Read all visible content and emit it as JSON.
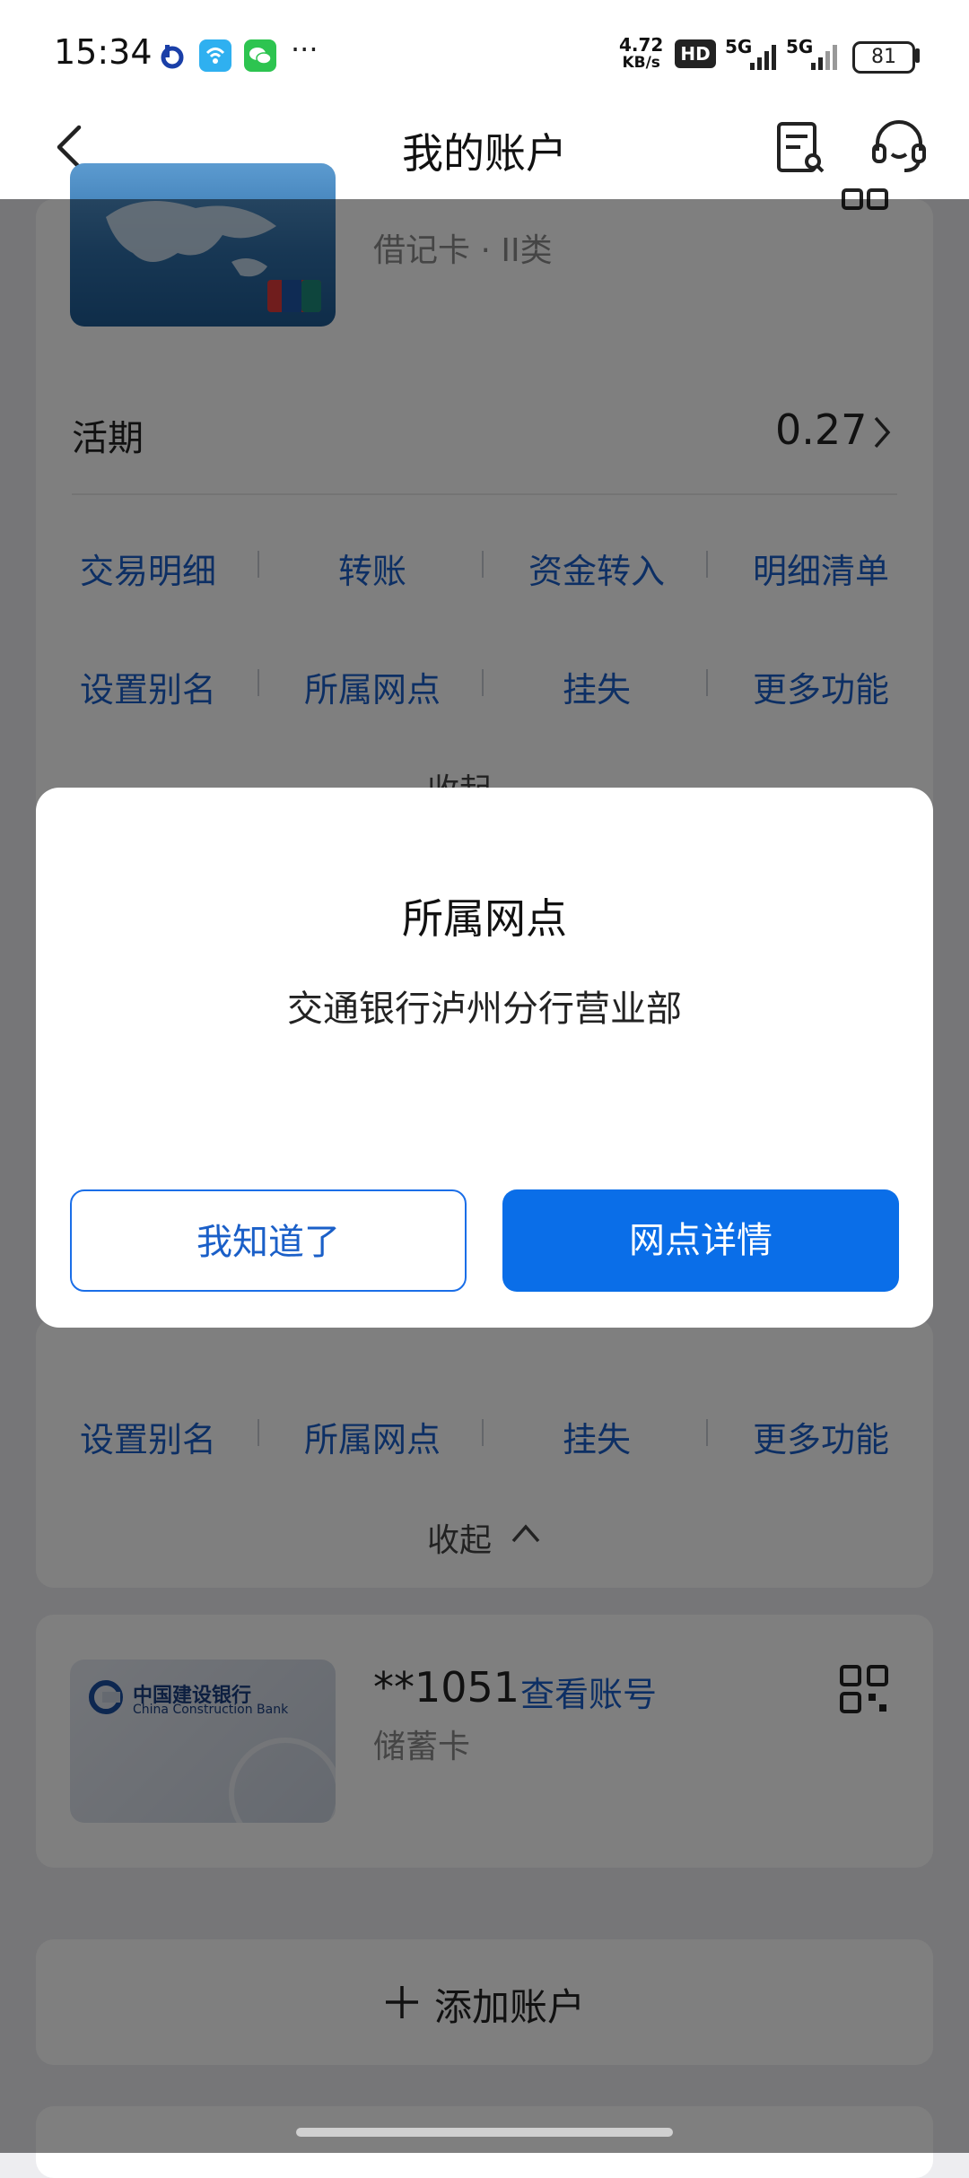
{
  "status_bar": {
    "time": "15:34",
    "net_speed_value": "4.72",
    "net_speed_unit": "KB/s",
    "hd": "HD",
    "signal1": "5G",
    "signal2": "5G",
    "battery": "81",
    "more": "···"
  },
  "header": {
    "title": "我的账户"
  },
  "account1": {
    "type": "借记卡 · II类",
    "balance_label": "活期",
    "balance_value": "0.27",
    "functions_row1": [
      "交易明细",
      "转账",
      "资金转入",
      "明细清单"
    ],
    "functions_row2": [
      "设置别名",
      "所属网点",
      "挂失",
      "更多功能"
    ],
    "collapse": "收起"
  },
  "account2": {
    "functions_row2": [
      "设置别名",
      "所属网点",
      "挂失",
      "更多功能"
    ],
    "collapse": "收起"
  },
  "account3": {
    "number": "**1051",
    "view_link": "查看账号",
    "type": "储蓄卡",
    "bank_name_cn": "中国建设银行",
    "bank_name_en": "China Construction Bank"
  },
  "add_account": {
    "label": "添加账户"
  },
  "dialog": {
    "title": "所属网点",
    "message": "交通银行泸州分行营业部",
    "ok_label": "我知道了",
    "detail_label": "网点详情"
  },
  "colors": {
    "accent": "#0a6ee8",
    "link": "#1a5fc8"
  }
}
